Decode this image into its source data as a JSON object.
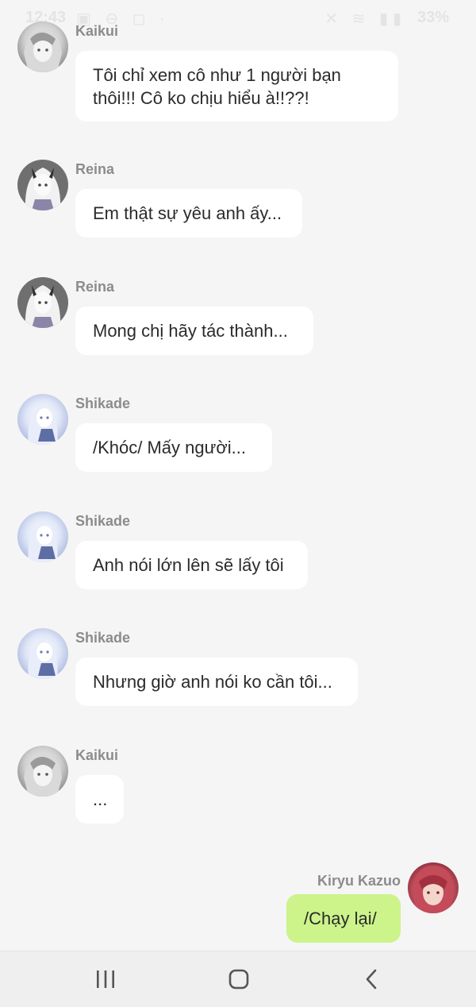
{
  "status_bar": {
    "time": "12:43",
    "left_icons": "▣ ⊖ ◻ ·",
    "right_icons": "✕ ≋ ▮▮",
    "battery": "33%"
  },
  "messages": [
    {
      "side": "left",
      "sender": "Kaikui",
      "text": "Tôi chỉ xem cô như 1 người bạn thôi!!! Cô ko chịu hiểu à!!??!",
      "avatar": "kaikui-avatar"
    },
    {
      "side": "left",
      "sender": "Reina",
      "text": "Em thật sự yêu anh ấy...",
      "avatar": "reina-avatar"
    },
    {
      "side": "left",
      "sender": "Reina",
      "text": "Mong chị hãy tác thành...",
      "avatar": "reina-avatar"
    },
    {
      "side": "left",
      "sender": "Shikade",
      "text": "/Khóc/ Mấy người...",
      "avatar": "shikade-avatar"
    },
    {
      "side": "left",
      "sender": "Shikade",
      "text": "Anh nói lớn lên sẽ lấy tôi",
      "avatar": "shikade-avatar"
    },
    {
      "side": "left",
      "sender": "Shikade",
      "text": "Nhưng giờ anh nói ko cần tôi...",
      "avatar": "shikade-avatar"
    },
    {
      "side": "left",
      "sender": "Kaikui",
      "text": "...",
      "avatar": "kaikui-avatar"
    },
    {
      "side": "right",
      "sender": "Kiryu Kazuo",
      "text": "/Chạy lại/",
      "avatar": "kiryu-avatar"
    }
  ],
  "nav_bar": {
    "recents": "recents-icon",
    "home": "home-icon",
    "back": "back-icon"
  },
  "colors": {
    "background": "#f5f5f5",
    "bubble_incoming": "#ffffff",
    "bubble_outgoing": "#ccf48a",
    "sender_name": "#8c8c8c"
  }
}
